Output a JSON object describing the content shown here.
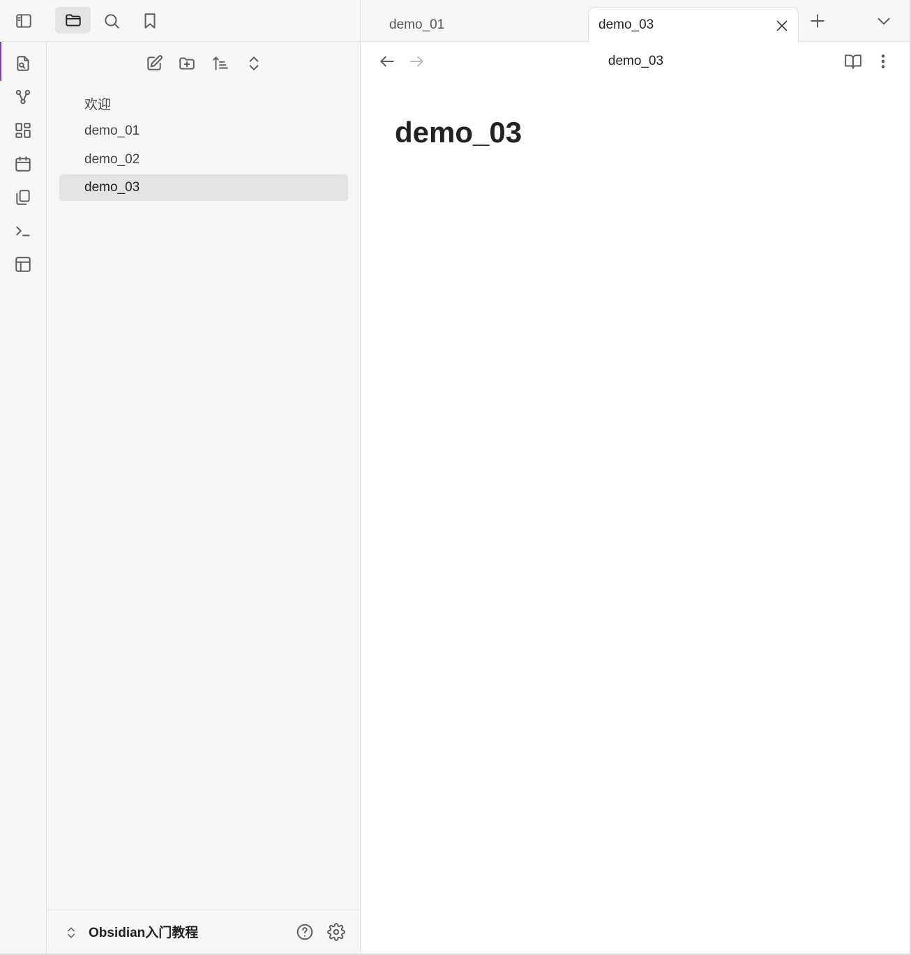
{
  "left_toolbar": {
    "icons": [
      "sidebar-toggle-icon",
      "folder-icon",
      "search-icon",
      "bookmark-icon"
    ]
  },
  "ribbon": {
    "icons": [
      "quick-switcher-icon",
      "graph-view-icon",
      "canvas-icon",
      "daily-note-icon",
      "templates-icon",
      "command-palette-icon",
      "layout-icon"
    ]
  },
  "explorer": {
    "actions": [
      "new-note-icon",
      "new-folder-icon",
      "sort-icon",
      "collapse-icon"
    ],
    "items": [
      {
        "label": "欢迎"
      },
      {
        "label": "demo_01"
      },
      {
        "label": "demo_02"
      },
      {
        "label": "demo_03",
        "selected": true
      }
    ]
  },
  "vault": {
    "name": "Obsidian入门教程"
  },
  "tabs": [
    {
      "label": "demo_01",
      "active": false
    },
    {
      "label": "demo_03",
      "active": true
    }
  ],
  "view": {
    "title": "demo_03",
    "doc_heading": "demo_03"
  },
  "colors": {
    "accent": "#7b3fc7",
    "panel_bg": "#f6f6f6",
    "selected_bg": "#e3e3e3",
    "border": "#e1e1e1"
  }
}
